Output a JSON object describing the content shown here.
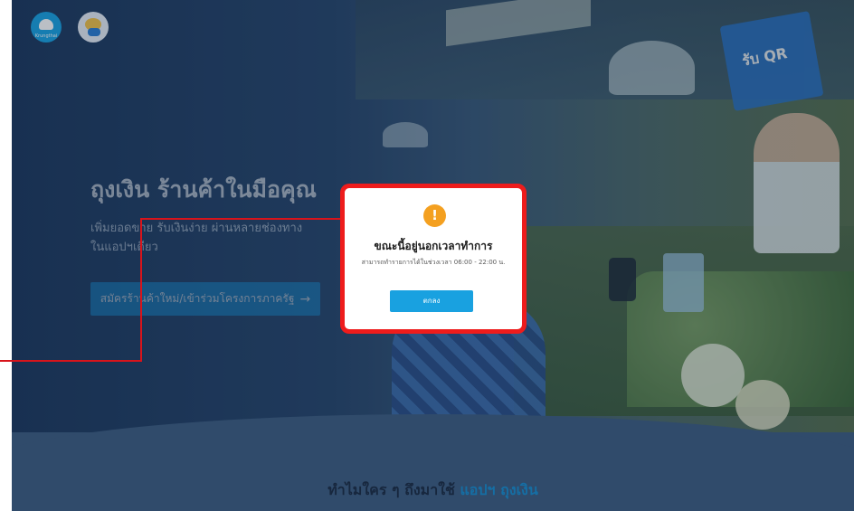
{
  "logos": {
    "bank": "Krungthai",
    "app": "เป๋าตัง"
  },
  "photo": {
    "qr_sign": "รับ QR"
  },
  "hero": {
    "title": "ถุงเงิน ร้านค้าในมือคุณ",
    "subtitle_line1": "เพิ่มยอดขาย รับเงินง่าย ผ่านหลายช่องทาง",
    "subtitle_line2": "ในแอปฯเดียว",
    "cta_label": "สมัครร้านค้าใหม่/เข้าร่วมโครงการภาครัฐ",
    "cta_arrow": "→"
  },
  "why": {
    "prefix": "ทำไมใคร ๆ ถึงมาใช้",
    "highlight": "แอปฯ ถุงเงิน"
  },
  "modal": {
    "icon": "!",
    "title": "ขณะนี้อยู่นอกเวลาทำการ",
    "message": "สามารถทำรายการได้ในช่วงเวลา 06:00 - 22:00 น.",
    "ok_label": "ตกลง"
  },
  "colors": {
    "accent": "#1a8fd2",
    "annotation": "#ee1c1c",
    "warning": "#f4a020"
  }
}
